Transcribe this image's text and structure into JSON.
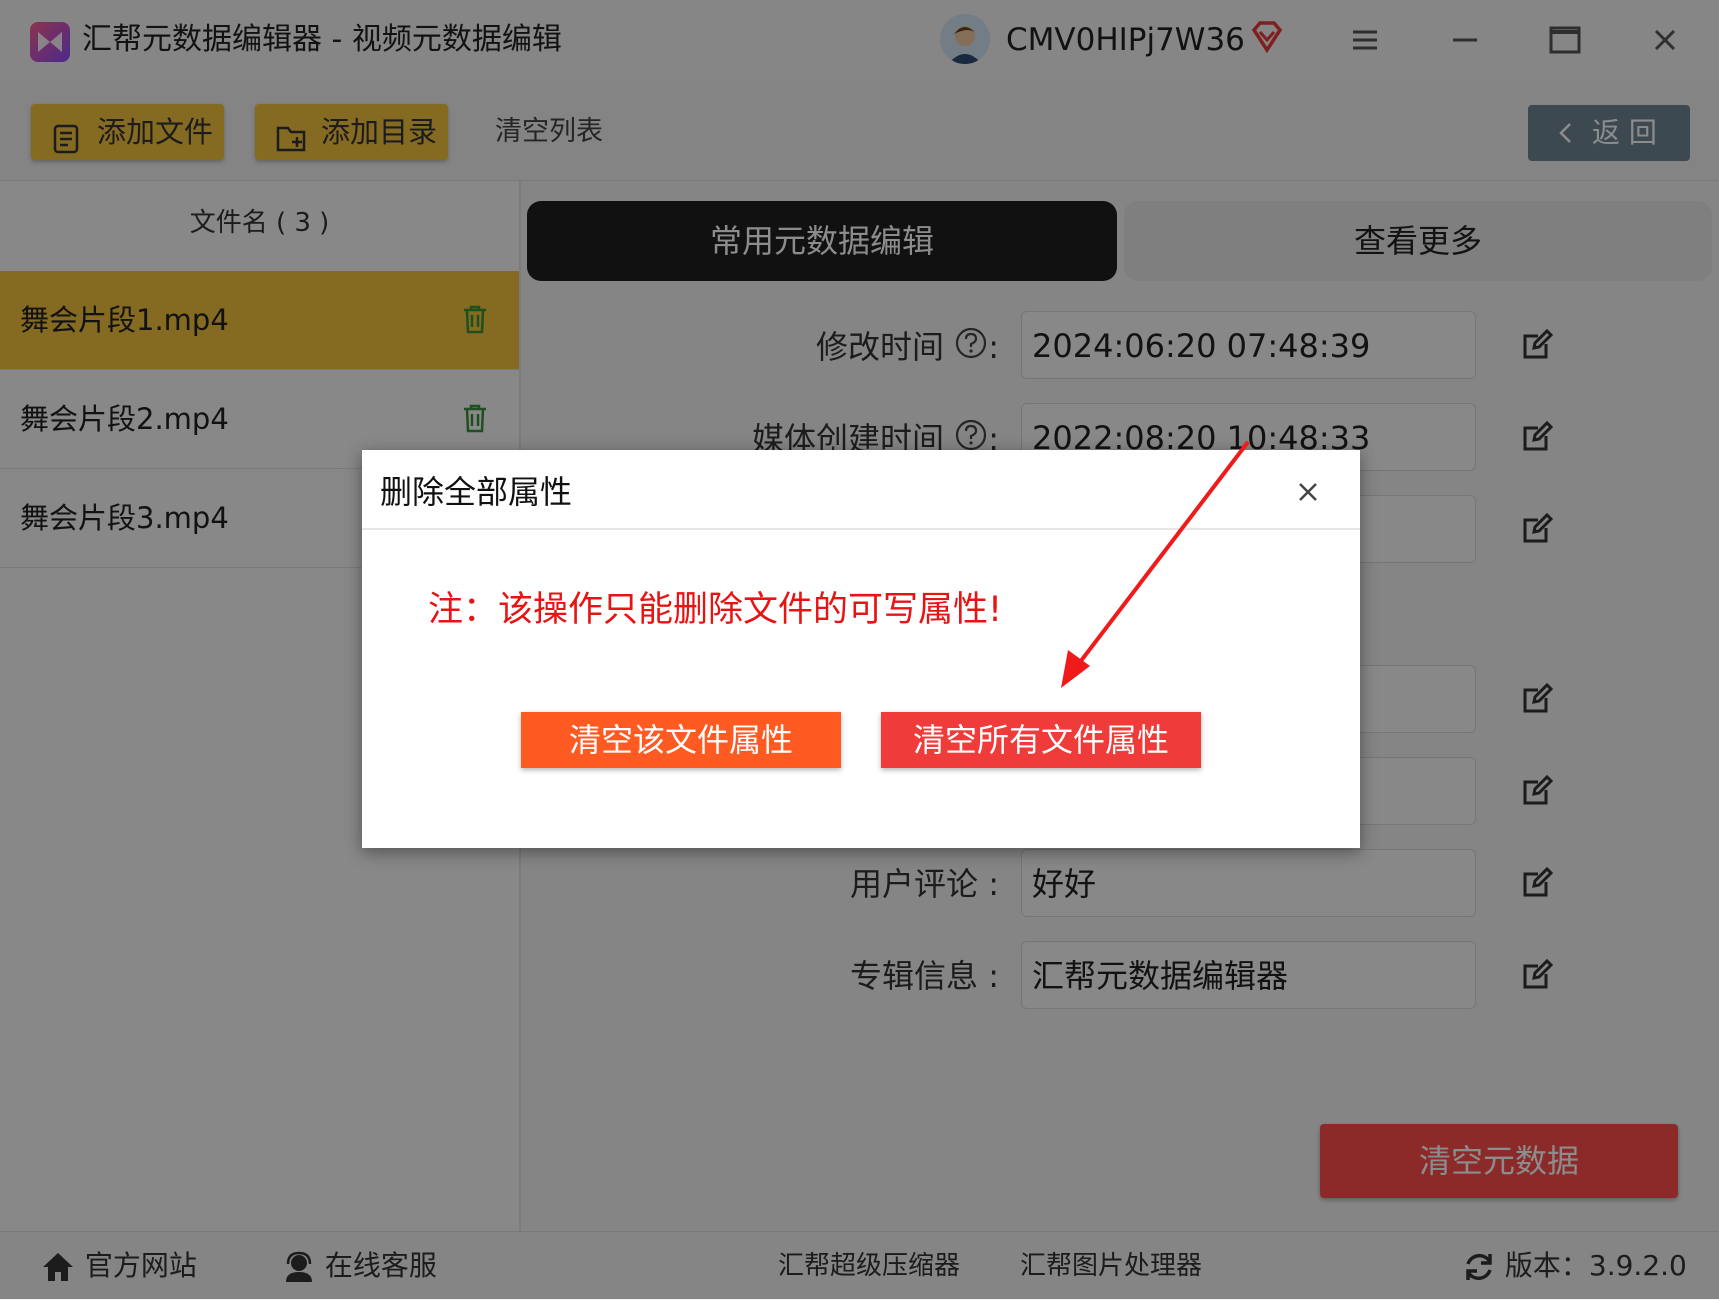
{
  "window": {
    "title": "汇帮元数据编辑器 - 视频元数据编辑",
    "username": "CMV0HIPj7W36"
  },
  "toolbar": {
    "add_file": "添加文件",
    "add_dir": "添加目录",
    "clear_list": "清空列表",
    "back": "返 回"
  },
  "file_list": {
    "header": "文件名 ( 3 )",
    "items": [
      {
        "name": "舞会片段1.mp4",
        "selected": true
      },
      {
        "name": "舞会片段2.mp4",
        "selected": false
      },
      {
        "name": "舞会片段3.mp4",
        "selected": false
      }
    ]
  },
  "tabs": {
    "common": "常用元数据编辑",
    "more": "查看更多"
  },
  "fields": [
    {
      "label": "修改时间",
      "value": "2024:06:20 07:48:39"
    },
    {
      "label": "媒体创建时间",
      "value": "2022:08:20 10:48:33"
    },
    {
      "label": "用户评论 :",
      "value": "好好"
    },
    {
      "label": "专辑信息 :",
      "value": "汇帮元数据编辑器"
    }
  ],
  "clear_meta_button": "清空元数据",
  "footer": {
    "website": "官方网站",
    "support": "在线客服",
    "compressor": "汇帮超级压缩器",
    "image_tool": "汇帮图片处理器",
    "version": "版本：3.9.2.0"
  },
  "dialog": {
    "title": "删除全部属性",
    "note": "注：该操作只能删除文件的可写属性!",
    "btn_clear_this": "清空该文件属性",
    "btn_clear_all": "清空所有文件属性"
  },
  "colors": {
    "accent_yellow": "#f2c23d",
    "warning_red": "#e81313",
    "btn_orange": "#ff5a22",
    "btn_red": "#f03b3b"
  }
}
